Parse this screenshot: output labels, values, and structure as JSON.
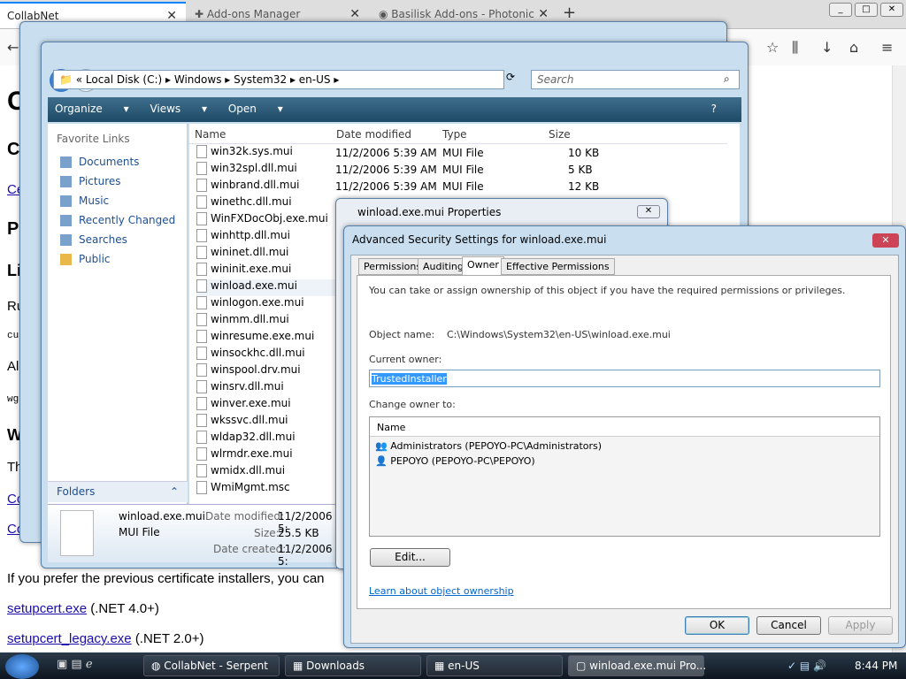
{
  "browser": {
    "tabs": [
      {
        "label": "CollabNet"
      },
      {
        "label": "Add-ons Manager"
      },
      {
        "label": "Basilisk Add-ons - Photonic"
      }
    ],
    "newtab": "+"
  },
  "webpage": {
    "lines": [
      {
        "text": "If you prefer the previous certificate installers, you can"
      },
      {
        "link": "setupcert.exe",
        "rest": "(.NET 4.0+)"
      },
      {
        "link": "setupcert_legacy.exe",
        "rest": "(.NET 2.0+)"
      }
    ],
    "fragments": [
      "C",
      "C",
      "Ce",
      "P",
      "Li",
      "Ru",
      "cu",
      "Al",
      "wg",
      "W",
      "Th",
      "Co",
      "Co"
    ]
  },
  "explorer": {
    "breadcrumb": [
      "Local Disk (C:)",
      "Windows",
      "System32",
      "en-US"
    ],
    "search_placeholder": "Search",
    "toolbar": {
      "organize": "Organize",
      "views": "Views",
      "open": "Open"
    },
    "favorites_title": "Favorite Links",
    "favorites": [
      "Documents",
      "Pictures",
      "Music",
      "Recently Changed",
      "Searches",
      "Public"
    ],
    "folders_label": "Folders",
    "columns": {
      "name": "Name",
      "date": "Date modified",
      "type": "Type",
      "size": "Size"
    },
    "files": [
      {
        "name": "win32k.sys.mui",
        "date": "11/2/2006 5:39 AM",
        "type": "MUI File",
        "size": "10 KB"
      },
      {
        "name": "win32spl.dll.mui",
        "date": "11/2/2006 5:39 AM",
        "type": "MUI File",
        "size": "5 KB"
      },
      {
        "name": "winbrand.dll.mui",
        "date": "11/2/2006 5:39 AM",
        "type": "MUI File",
        "size": "12 KB"
      },
      {
        "name": "winethc.dll.mui"
      },
      {
        "name": "WinFXDocObj.exe.mui"
      },
      {
        "name": "winhttp.dll.mui"
      },
      {
        "name": "wininet.dll.mui"
      },
      {
        "name": "wininit.exe.mui"
      },
      {
        "name": "winload.exe.mui"
      },
      {
        "name": "winlogon.exe.mui"
      },
      {
        "name": "winmm.dll.mui"
      },
      {
        "name": "winresume.exe.mui"
      },
      {
        "name": "winsockhc.dll.mui"
      },
      {
        "name": "winspool.drv.mui"
      },
      {
        "name": "winsrv.dll.mui"
      },
      {
        "name": "winver.exe.mui"
      },
      {
        "name": "wkssvc.dll.mui"
      },
      {
        "name": "wldap32.dll.mui"
      },
      {
        "name": "wlrmdr.exe.mui"
      },
      {
        "name": "wmidx.dll.mui"
      },
      {
        "name": "WmiMgmt.msc"
      }
    ],
    "details": {
      "name": "winload.exe.mui",
      "type": "MUI File",
      "modified_label": "Date modified:",
      "modified_value": "11/2/2006 5:",
      "size_label": "Size:",
      "size_value": "25.5 KB",
      "created_label": "Date created:",
      "created_value": "11/2/2006 5:"
    }
  },
  "properties": {
    "title": "winload.exe.mui Properties"
  },
  "advanced": {
    "title": "Advanced Security Settings for winload.exe.mui",
    "tabs": [
      "Permissions",
      "Auditing",
      "Owner",
      "Effective Permissions"
    ],
    "intro": "You can take or assign ownership of this object if you have the required permissions or privileges.",
    "object_label": "Object name:",
    "object_value": "C:\\Windows\\System32\\en-US\\winload.exe.mui",
    "current_owner_label": "Current owner:",
    "current_owner_value": "TrustedInstaller",
    "change_owner_label": "Change owner to:",
    "list_header": "Name",
    "owners": [
      "Administrators (PEPOYO-PC\\Administrators)",
      "PEPOYO (PEPOYO-PC\\PEPOYO)"
    ],
    "edit_button": "Edit...",
    "learn_link": "Learn about object ownership",
    "ok": "OK",
    "cancel": "Cancel",
    "apply": "Apply"
  },
  "taskbar": {
    "items": [
      "CollabNet - Serpent",
      "Downloads",
      "en-US",
      "winload.exe.mui Pro..."
    ],
    "clock": "8:44 PM"
  }
}
